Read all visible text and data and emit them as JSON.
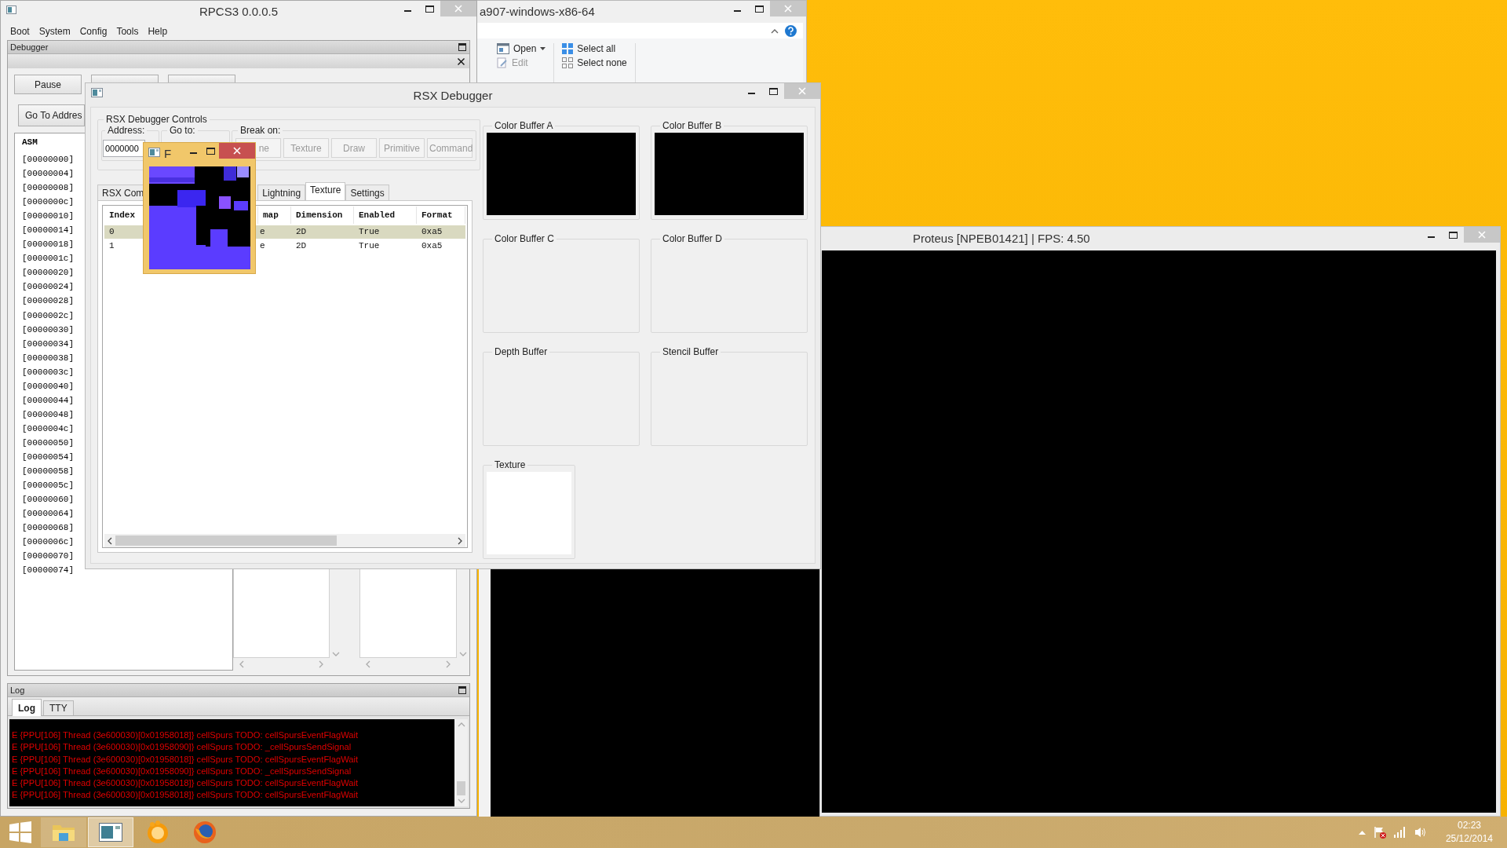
{
  "explorer_window": {
    "title": "a907-windows-x86-64",
    "ribbon": [
      {
        "label": "Open",
        "kind": "open",
        "disabled": false
      },
      {
        "label": "Edit",
        "kind": "edit",
        "disabled": true
      },
      {
        "label": "Select all",
        "kind": "select-all",
        "disabled": false
      },
      {
        "label": "Select none",
        "kind": "select-none",
        "disabled": false
      }
    ]
  },
  "rpcs3_window": {
    "title": "RPCS3 0.0.0.5",
    "menu": [
      "Boot",
      "System",
      "Config",
      "Tools",
      "Help"
    ],
    "debugger": {
      "title": "Debugger",
      "buttons": [
        {
          "kind": "labeled",
          "label": "Pause"
        },
        {
          "kind": "covered"
        },
        {
          "kind": "covered"
        }
      ],
      "goto_button": "Go To Addres",
      "asm_header": "ASM",
      "asm_rows": [
        "[00000000]",
        "[00000004]",
        "[00000008]",
        "[0000000c]",
        "[00000010]",
        "[00000014]",
        "[00000018]",
        "[0000001c]",
        "[00000020]",
        "[00000024]",
        "[00000028]",
        "[0000002c]",
        "[00000030]",
        "[00000034]",
        "[00000038]",
        "[0000003c]",
        "[00000040]",
        "[00000044]",
        "[00000048]",
        "[0000004c]",
        "[00000050]",
        "[00000054]",
        "[00000058]",
        "[0000005c]",
        "[00000060]",
        "[00000064]",
        "[00000068]",
        "[0000006c]",
        "[00000070]",
        "[00000074]"
      ]
    },
    "log": {
      "title": "Log",
      "tabs": [
        {
          "label": "Log",
          "selected": true
        },
        {
          "label": "TTY",
          "selected": false
        }
      ],
      "lines": [
        "E {PPU[106] Thread (3e600030)[0x01958018]} cellSpurs TODO: cellSpursEventFlagWait",
        "E {PPU[106] Thread (3e600030)[0x01958090]} cellSpurs TODO: _cellSpursSendSignal",
        "E {PPU[106] Thread (3e600030)[0x01958018]} cellSpurs TODO: cellSpursEventFlagWait",
        "E {PPU[106] Thread (3e600030)[0x01958090]} cellSpurs TODO: _cellSpursSendSignal",
        "E {PPU[106] Thread (3e600030)[0x01958018]} cellSpurs TODO: cellSpursEventFlagWait",
        "E {PPU[106] Thread (3e600030)[0x01958018]} cellSpurs TODO: cellSpursEventFlagWait"
      ]
    }
  },
  "rsx_debugger": {
    "title": "RSX Debugger",
    "controls": {
      "title": "RSX Debugger Controls",
      "address_label": "Address:",
      "address_value": "0000000",
      "goto_label": "Go to:",
      "break_label": "Break on:",
      "break_buttons": [
        {
          "label": "ne",
          "disabled": true
        },
        {
          "label": "Texture",
          "disabled": true
        },
        {
          "label": "Draw",
          "disabled": true
        },
        {
          "label": "Primitive",
          "disabled": true
        },
        {
          "label": "Command",
          "disabled": true
        }
      ]
    },
    "tabs": [
      {
        "label": "RSX Com",
        "selected": false
      },
      {
        "label": "Lightning",
        "selected": false
      },
      {
        "label": "Texture",
        "selected": true
      },
      {
        "label": "Settings",
        "selected": false
      }
    ],
    "table": {
      "columns": [
        "Index",
        "map",
        "Dimension",
        "Enabled",
        "Format"
      ],
      "rows": [
        {
          "cells": [
            "0",
            "e",
            "2D",
            "True",
            "0xa5"
          ],
          "selected": true
        },
        {
          "cells": [
            "1",
            "e",
            "2D",
            "True",
            "0xa5"
          ],
          "selected": false
        }
      ]
    },
    "buffers": [
      {
        "label": "Color Buffer A",
        "kind": "output"
      },
      {
        "label": "Color Buffer B",
        "kind": "output"
      },
      {
        "label": "Color Buffer C",
        "kind": "empty"
      },
      {
        "label": "Color Buffer D",
        "kind": "empty"
      },
      {
        "label": "Depth Buffer",
        "kind": "empty"
      },
      {
        "label": "Stencil Buffer",
        "kind": "empty"
      },
      {
        "label": "Texture",
        "kind": "white"
      }
    ]
  },
  "texture_popup": {
    "title": "F"
  },
  "proteus_window": {
    "title": "Proteus [NPEB01421] | FPS: 4.50"
  },
  "taskbar": {
    "apps": [
      {
        "kind": "folder",
        "running": true,
        "selected": false
      },
      {
        "kind": "app-window",
        "running": true,
        "selected": true
      },
      {
        "kind": "orange-ball",
        "running": false,
        "selected": false
      },
      {
        "kind": "fox-globe",
        "running": false,
        "selected": false
      }
    ],
    "clock": {
      "time": "02:23",
      "date": "25/12/2014"
    }
  }
}
